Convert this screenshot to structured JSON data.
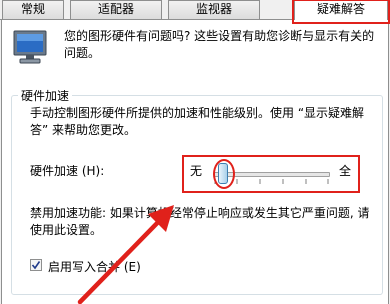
{
  "tabs": [
    {
      "label": "常规"
    },
    {
      "label": "适配器"
    },
    {
      "label": "监视器"
    },
    {
      "label": "疑难解答",
      "active": true
    }
  ],
  "intro": {
    "text": "您的图形硬件有问题吗? 这些设置有助您诊断与显示有关的问题。"
  },
  "hardware_acceleration": {
    "group_title": "硬件加速",
    "description": "手动控制图形硬件所提供的加速和性能级别。使用 “显示疑难解答” 来帮助您更改。",
    "label": "硬件加速 (H):",
    "slider": {
      "min_label": "无",
      "max_label": "全",
      "value_fraction": 0.0
    },
    "hint": "禁用加速功能: 如果计算机经常停止响应或发生其它严重问题, 请使用此设置。"
  },
  "write_combining": {
    "label": "启用写入合并 (E)",
    "checked": true
  },
  "colors": {
    "annotation_red": "#e0211b",
    "accent_blue": "#3c7fb1"
  },
  "icons": {
    "monitor": "monitor-icon",
    "checkmark": "checkmark-icon"
  }
}
